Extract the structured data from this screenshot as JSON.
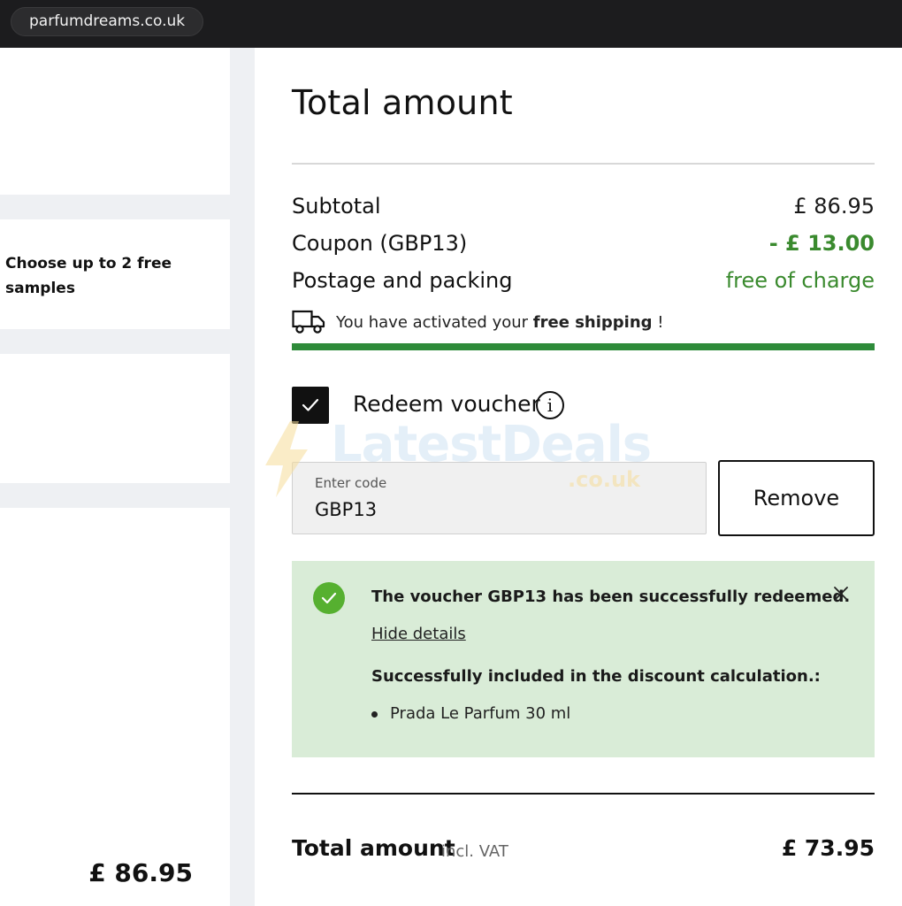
{
  "browser": {
    "url": "parfumdreams.co.uk"
  },
  "left": {
    "samples_text": "Choose up to 2 free samples",
    "price": "£ 86.95"
  },
  "summary": {
    "title": "Total amount",
    "subtotal_label": "Subtotal",
    "subtotal_value": "£ 86.95",
    "coupon_label": "Coupon (GBP13)",
    "coupon_value": "- £ 13.00",
    "postage_label": "Postage and packing",
    "postage_value": "free of charge",
    "ship_note_pre": "You have activated your",
    "ship_note_bold": "free shipping",
    "ship_note_post": "!",
    "shipping_progress": 1.0
  },
  "voucher": {
    "checkbox_checked": true,
    "label": "Redeem voucher",
    "info_glyph": "i",
    "input_placeholder": "Enter code",
    "input_value": "GBP13",
    "remove_label": "Remove"
  },
  "success": {
    "message": "The voucher GBP13 has been successfully redeemed.",
    "hide_details": "Hide details",
    "included_heading": "Successfully included in the discount calculation.:",
    "items": [
      "Prada Le Parfum 30 ml"
    ]
  },
  "total": {
    "label": "Total amount",
    "vat_note": "incl. VAT",
    "value": "£ 73.95"
  },
  "watermark": {
    "text": "LatestDeals",
    "sub": ".co.uk"
  },
  "icons": {
    "truck": "truck-icon",
    "check": "checkmark-icon",
    "info": "info-icon",
    "success": "success-check-icon",
    "close": "close-icon"
  },
  "colors": {
    "accent_green": "#3a8a2e",
    "progress_green": "#2e8b3a",
    "success_bg": "#d9ecd7",
    "success_icon": "#56b030",
    "topbar": "#1c1c1e"
  }
}
